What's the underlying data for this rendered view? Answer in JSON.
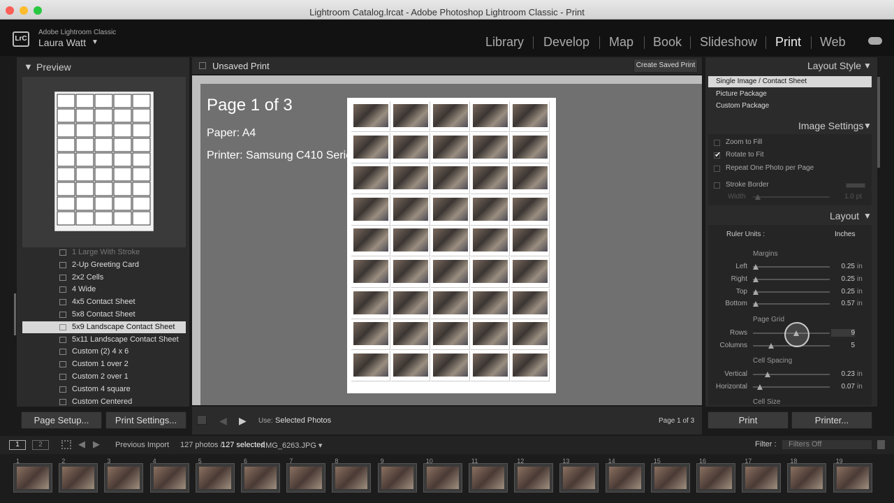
{
  "window_title": "Lightroom Catalog.lrcat - Adobe Photoshop Lightroom Classic - Print",
  "identity": {
    "logo": "LrC",
    "app_name": "Adobe Lightroom Classic",
    "user": "Laura Watt",
    "user_arrow": "▼"
  },
  "modules": [
    "Library",
    "Develop",
    "Map",
    "Book",
    "Slideshow",
    "Print",
    "Web"
  ],
  "active_module": "Print",
  "left_panel": {
    "preview_title": "Preview",
    "collapse_glyph": "▼",
    "templates": [
      "1 Large With Stroke",
      "2-Up Greeting Card",
      "2x2 Cells",
      "4 Wide",
      "4x5 Contact Sheet",
      "5x8 Contact Sheet",
      "5x9 Landscape Contact Sheet",
      "5x11 Landscape Contact Sheet",
      "Custom (2) 4 x 6",
      "Custom 1 over 2",
      "Custom 2 over 1",
      "Custom 4 square",
      "Custom Centered"
    ],
    "selected_template": "5x9 Landscape Contact Sheet",
    "page_setup_label": "Page Setup...",
    "print_settings_label": "Print Settings..."
  },
  "center": {
    "doc_title": "Unsaved Print",
    "create_saved_label": "Create Saved Print",
    "page_info": "Page 1 of 3",
    "paper": "Paper:  A4",
    "printer": "Printer:  Samsung C410 Series",
    "grid": {
      "rows": 9,
      "cols": 5
    },
    "toolbar": {
      "use_label": "Use:",
      "use_value": "Selected Photos",
      "page_counter": "Page 1 of 3"
    }
  },
  "right_panel": {
    "layout_style": {
      "title": "Layout Style",
      "options": [
        "Single Image / Contact Sheet",
        "Picture Package",
        "Custom Package"
      ],
      "selected": "Single Image / Contact Sheet"
    },
    "image_settings": {
      "title": "Image Settings",
      "options": [
        {
          "label": "Zoom to Fill",
          "checked": false
        },
        {
          "label": "Rotate to Fit",
          "checked": true
        },
        {
          "label": "Repeat One Photo per Page",
          "checked": false
        },
        {
          "label": "Stroke Border",
          "checked": false
        }
      ],
      "width_label": "Width",
      "width_value": "1.0 pt"
    },
    "layout": {
      "title": "Layout",
      "ruler_label": "Ruler Units :",
      "ruler_value": "Inches",
      "margins_title": "Margins",
      "margins": [
        {
          "label": "Left",
          "value": "0.25",
          "unit": "in",
          "level": 0
        },
        {
          "label": "Right",
          "value": "0.25",
          "unit": "in",
          "level": 0
        },
        {
          "label": "Top",
          "value": "0.25",
          "unit": "in",
          "level": 0
        },
        {
          "label": "Bottom",
          "value": "0.57",
          "unit": "in",
          "level": 0
        }
      ],
      "page_grid_title": "Page Grid",
      "page_grid": [
        {
          "label": "Rows",
          "value": "9",
          "level": 0.53
        },
        {
          "label": "Columns",
          "value": "5",
          "level": 0.2
        }
      ],
      "cell_spacing_title": "Cell Spacing",
      "cell_spacing": [
        {
          "label": "Vertical",
          "value": "0.23",
          "unit": "in",
          "level": 0.15
        },
        {
          "label": "Horizontal",
          "value": "0.07",
          "unit": "in",
          "level": 0.05
        }
      ],
      "cell_size_title": "Cell Size"
    },
    "print_label": "Print",
    "printer_label": "Printer..."
  },
  "filmstrip": {
    "view1": "1",
    "view2": "2",
    "source": "Previous Import",
    "count_text": "127 photos /",
    "selected_text": "127 selected",
    "file_text": "/IMG_6263.JPG ▾",
    "filter_label": "Filter :",
    "filter_value": "Filters Off",
    "numbers": [
      "1",
      "2",
      "3",
      "4",
      "5",
      "6",
      "7",
      "8",
      "9",
      "10",
      "11",
      "12",
      "13",
      "14",
      "15",
      "16",
      "17",
      "18",
      "19"
    ]
  },
  "colors": {
    "selected_row": "#d8d8d8",
    "panel": "#2b2b2b",
    "workspace": "#707070"
  }
}
